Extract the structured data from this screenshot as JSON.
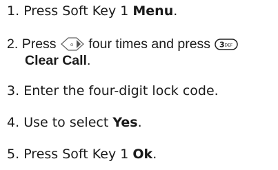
{
  "steps": [
    {
      "number": "1.",
      "text": "Press Soft Key 1",
      "bold": "Menu",
      "end": "."
    },
    {
      "number": "2.",
      "text_a": "Press",
      "icon_a": "nav-key-icon",
      "text_b": "four times and press",
      "icon_b": "key-3-icon",
      "key_label": "3",
      "key_letters": "DEF",
      "bold": "Clear Call",
      "end": "."
    },
    {
      "number": "3.",
      "text": "Enter the four-digit lock code."
    },
    {
      "number": "4.",
      "text": "Use to select",
      "bold": "Yes",
      "end": "."
    },
    {
      "number": "5.",
      "text": "Press Soft Key 1",
      "bold": "Ok",
      "end": "."
    }
  ]
}
